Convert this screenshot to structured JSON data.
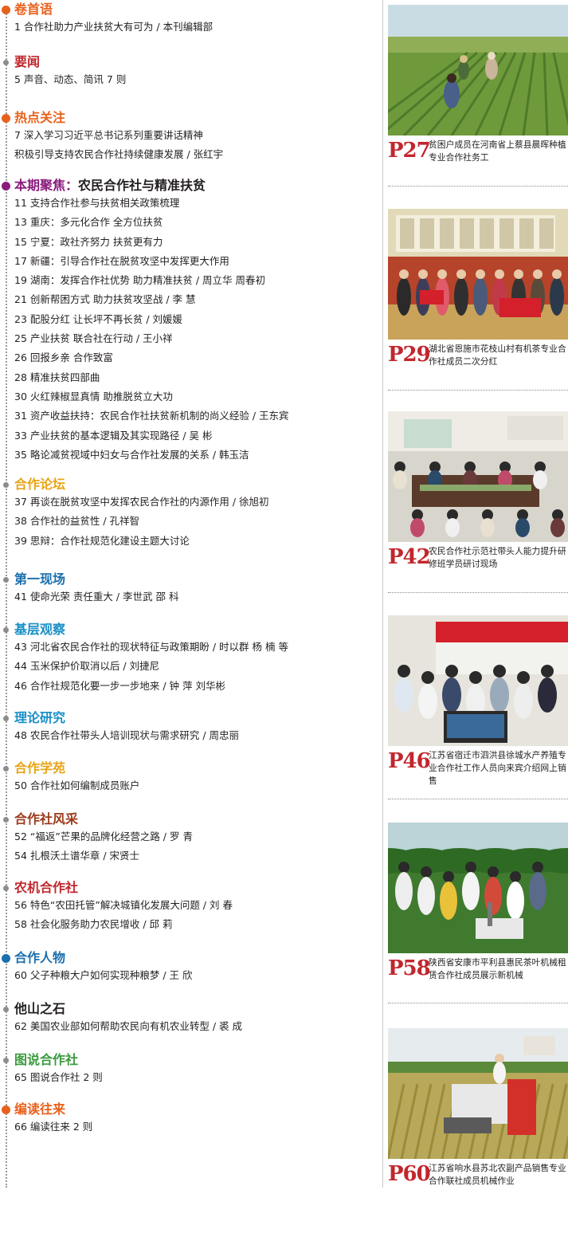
{
  "sections": [
    {
      "title": "卷首语",
      "sub": "",
      "color": "#e8611c",
      "dot": "big",
      "items": [
        "1  合作社助力产业扶贫大有可为 / 本刊编辑部"
      ]
    },
    {
      "title": "要闻",
      "sub": "",
      "color": "#c0272d",
      "dot": "small",
      "items": [
        "5  声音、动态、简讯 7 则"
      ]
    },
    {
      "title": "热点关注",
      "sub": "",
      "color": "#e8611c",
      "dot": "big",
      "items": [
        "7  深入学习习近平总书记系列重要讲话精神",
        "    积极引导支持农民合作社持续健康发展 / 张红宇"
      ]
    },
    {
      "title": "本期聚焦：",
      "sub": "农民合作社与精准扶贫",
      "color": "#8a1c7c",
      "dot": "big",
      "items": [
        "11 支持合作社参与扶贫相关政策梳理",
        "13 重庆：多元化合作  全方位扶贫",
        "15 宁夏：政社齐努力  扶贫更有力",
        "17 新疆：引导合作社在脱贫攻坚中发挥更大作用",
        "19 湖南：发挥合作社优势  助力精准扶贫 / 周立华   周春初",
        "21 创新帮困方式  助力扶贫攻坚战 / 李  慧",
        "23 配股分红  让长坪不再长贫 / 刘媛媛",
        "25 产业扶贫  联合社在行动 / 王小祥",
        "26 回报乡亲  合作致富",
        "28 精准扶贫四部曲",
        "30 火红辣椒显真情  助推脱贫立大功",
        "31 资产收益扶持：农民合作社扶贫新机制的尚义经验 / 王东宾",
        "33 产业扶贫的基本逻辑及其实现路径 / 吴  彬",
        "35 略论减贫视域中妇女与合作社发展的关系 / 韩玉洁"
      ]
    },
    {
      "title": "合作论坛",
      "sub": "",
      "color": "#e8a415",
      "dot": "small",
      "items": [
        "37 再谈在脱贫攻坚中发挥农民合作社的内源作用 / 徐旭初",
        "38 合作社的益贫性 / 孔祥智",
        "39 思辩：合作社规范化建设主题大讨论"
      ]
    },
    {
      "title": "第一现场",
      "sub": "",
      "color": "#1a6fae",
      "dot": "small",
      "items": [
        "41 使命光荣  责任重大 / 李世武   邵  科"
      ]
    },
    {
      "title": "基层观察",
      "sub": "",
      "color": "#1a8fc7",
      "dot": "small",
      "items": [
        "43 河北省农民合作社的现状特征与政策期盼 / 时以群   杨  楠   等",
        "44 玉米保护价取消以后 / 刘捷尼",
        "46 合作社规范化要一步一步地来 / 钟  萍   刘华彬"
      ]
    },
    {
      "title": "理论研究",
      "sub": "",
      "color": "#1a8fc7",
      "dot": "small",
      "items": [
        "48 农民合作社带头人培训现状与需求研究 / 周忠丽"
      ]
    },
    {
      "title": "合作学苑",
      "sub": "",
      "color": "#e8a415",
      "dot": "small",
      "items": [
        "50 合作社如何编制成员账户"
      ]
    },
    {
      "title": "合作社风采",
      "sub": "",
      "color": "#9a3b1c",
      "dot": "small",
      "items": [
        "52 “福返”芒果的品牌化经营之路 / 罗  青",
        "54 扎根沃土谱华章 / 宋贤士"
      ]
    },
    {
      "title": "农机合作社",
      "sub": "",
      "color": "#c0272d",
      "dot": "small",
      "items": [
        "56 特色“农田托管”解决城镇化发展大问题 / 刘  春",
        "58 社会化服务助力农民增收 / 邱  莉"
      ]
    },
    {
      "title": "合作人物",
      "sub": "",
      "color": "#1a6fae",
      "dot": "big",
      "items": [
        "60 父子种粮大户如何实现种粮梦 / 王  欣"
      ]
    },
    {
      "title": "他山之石",
      "sub": "",
      "color": "#231f20",
      "dot": "small",
      "items": [
        "62 美国农业部如何帮助农民向有机农业转型 / 裘  成"
      ]
    },
    {
      "title": "图说合作社",
      "sub": "",
      "color": "#3b9a3e",
      "dot": "small",
      "items": [
        "65 图说合作社 2 则"
      ]
    },
    {
      "title": "编读往来",
      "sub": "",
      "color": "#e8611c",
      "dot": "big",
      "items": [
        "66 编读往来 2 则"
      ]
    }
  ],
  "photos": [
    {
      "page": "P27",
      "caption": "贫困户成员在河南省上蔡县晨晖种植专业合作社务工",
      "scene": "field"
    },
    {
      "page": "P29",
      "caption": "湖北省恩施市花枝山村有机茶专业合作社成员二次分红",
      "scene": "ceremony"
    },
    {
      "page": "P42",
      "caption": "农民合作社示范社带头人能力提升研修班学员研讨现场",
      "scene": "meeting"
    },
    {
      "page": "P46",
      "caption": "江苏省宿迁市泗洪县徐城水产养殖专业合作社工作人员向来宾介绍网上销售",
      "scene": "computer"
    },
    {
      "page": "P58",
      "caption": "陕西省安康市平利县惠民茶叶机械租赁合作社成员展示新机械",
      "scene": "tea"
    },
    {
      "page": "P60",
      "caption": "江苏省响水县苏北农副产品销售专业合作联社成员机械作业",
      "scene": "harvest"
    }
  ]
}
